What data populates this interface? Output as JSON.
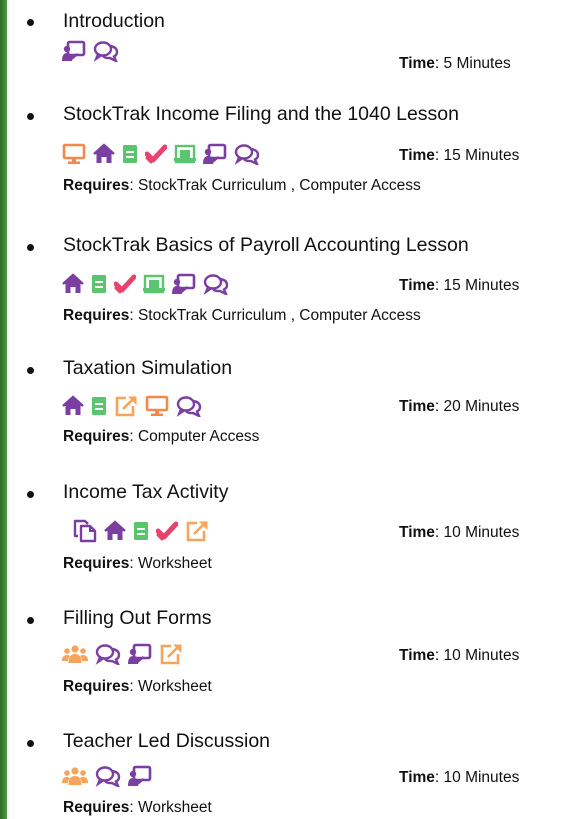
{
  "labels": {
    "time": "Time",
    "requires": "Requires",
    "sep": ": "
  },
  "colors": {
    "purple": "#7a3fa0",
    "orange": "#f4884a",
    "green": "#5bc46e",
    "pink": "#e8436c",
    "lightorange": "#f6a45b"
  },
  "items": [
    {
      "title": "Introduction",
      "time": "5 Minutes",
      "requires": "",
      "icons": [
        "presentation-icon",
        "discussion-icon"
      ]
    },
    {
      "title": "StockTrak Income Filing and the 1040 Lesson",
      "time": "15 Minutes",
      "requires": "StockTrak Curriculum , Computer Access",
      "icons": [
        "computer-icon",
        "home-icon",
        "notes-icon",
        "checkmark-icon",
        "worksheet-icon",
        "presentation-icon",
        "discussion-icon"
      ]
    },
    {
      "title": "StockTrak Basics of Payroll Accounting  Lesson",
      "time": "15 Minutes",
      "requires": "StockTrak Curriculum , Computer Access",
      "icons": [
        "home-icon",
        "notes-icon",
        "checkmark-icon",
        "worksheet-icon",
        "presentation-icon",
        "discussion-icon"
      ]
    },
    {
      "title": "Taxation Simulation",
      "time": "20 Minutes",
      "requires": "Computer Access",
      "icons": [
        "home-icon",
        "notes-icon",
        "external-link-icon",
        "computer-icon",
        "discussion-icon"
      ]
    },
    {
      "title": "Income Tax Activity",
      "time": "10 Minutes",
      "requires": " Worksheet",
      "icons": [
        "copy-icon",
        "home-icon",
        "notes-icon",
        "checkmark-icon",
        "external-link-icon"
      ]
    },
    {
      "title": "Filling  Out Forms",
      "time": "10 Minutes",
      "requires": "Worksheet",
      "icons": [
        "group-icon",
        "discussion-icon",
        "presentation-icon",
        "external-link-icon"
      ]
    },
    {
      "title": "Teacher Led Discussion",
      "time": "10 Minutes",
      "requires": "Worksheet",
      "icons": [
        "group-icon",
        "discussion-icon",
        "presentation-icon"
      ]
    }
  ]
}
